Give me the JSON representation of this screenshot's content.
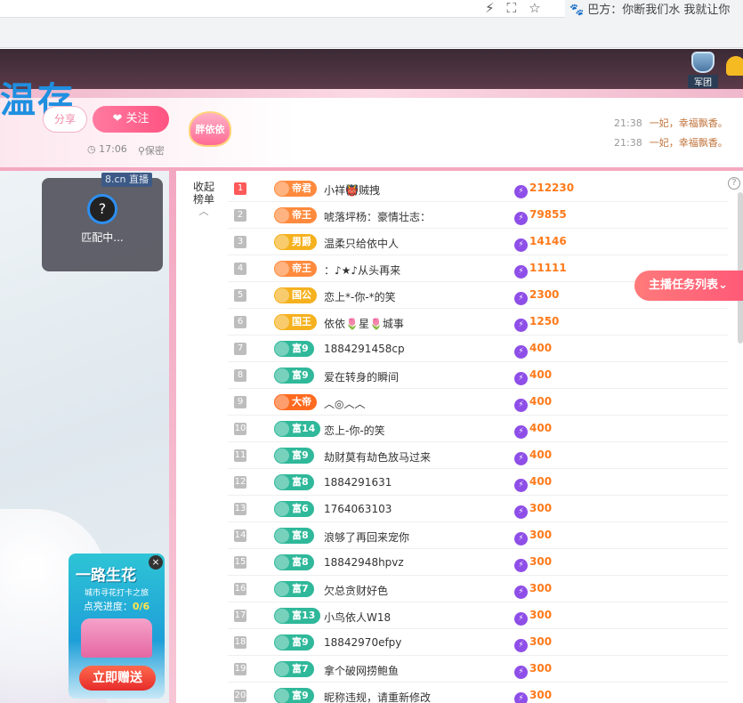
{
  "browser": {
    "extension_text": "巴方：你断我们水 我就让你"
  },
  "room": {
    "big_title": "温存",
    "share_label": "分享",
    "follow_label": "关注",
    "fan_badge": "胖依依",
    "time": "17:06",
    "location": "保密",
    "juntuan_label": "军团"
  },
  "chat": [
    {
      "time": "21:38",
      "text": "一妃，幸福飘香。"
    },
    {
      "time": "21:38",
      "text": "一妃，幸福飘香。"
    }
  ],
  "match": {
    "tag": "8.cn 直播",
    "text": "匹配中..."
  },
  "promo": {
    "title": "一路生花",
    "subtitle": "城市寻花打卡之旅",
    "progress_label": "点亮进度：",
    "progress_value": "0/6",
    "button": "立即赠送"
  },
  "board": {
    "collapse_label": "收起榜单",
    "task_button": "主播任务列表",
    "rows": [
      {
        "rank": "1",
        "badge": "帝君",
        "badge_color": "#ff8a3d",
        "name": "小祥👹贼拽",
        "score": "212230"
      },
      {
        "rank": "2",
        "badge": "帝王",
        "badge_color": "#ff8a3d",
        "name": "唬落坪杨：豪情壮志：",
        "score": "79855"
      },
      {
        "rank": "3",
        "badge": "男爵",
        "badge_color": "#f5b11e",
        "name": "温柔只给依中人",
        "score": "14146"
      },
      {
        "rank": "4",
        "badge": "帝王",
        "badge_color": "#ff8a3d",
        "name": "：♪★♪从头再来",
        "score": "11111"
      },
      {
        "rank": "5",
        "badge": "国公",
        "badge_color": "#f5b11e",
        "name": "恋上*-你-*的笑",
        "score": "2300"
      },
      {
        "rank": "6",
        "badge": "国王",
        "badge_color": "#f5b11e",
        "name": "依依🌷星🌷城事",
        "score": "1250"
      },
      {
        "rank": "7",
        "badge": "富9",
        "badge_color": "#2fb89a",
        "name": "1884291458cp",
        "score": "400"
      },
      {
        "rank": "8",
        "badge": "富9",
        "badge_color": "#2fb89a",
        "name": "爱在转身的瞬间",
        "score": "400"
      },
      {
        "rank": "9",
        "badge": "大帝",
        "badge_color": "#ff6a1f",
        "name": "︿◎︿︿",
        "score": "400"
      },
      {
        "rank": "10",
        "badge": "富14",
        "badge_color": "#2fb89a",
        "name": "恋上-你-的笑",
        "score": "400"
      },
      {
        "rank": "11",
        "badge": "富9",
        "badge_color": "#2fb89a",
        "name": "劫财莫有劫色放马过来",
        "score": "400"
      },
      {
        "rank": "12",
        "badge": "富8",
        "badge_color": "#2fb89a",
        "name": "1884291631",
        "score": "400"
      },
      {
        "rank": "13",
        "badge": "富6",
        "badge_color": "#2fb89a",
        "name": "1764063103",
        "score": "300"
      },
      {
        "rank": "14",
        "badge": "富8",
        "badge_color": "#2fb89a",
        "name": "浪够了再回来宠你",
        "score": "300"
      },
      {
        "rank": "15",
        "badge": "富8",
        "badge_color": "#2fb89a",
        "name": "18842948hpvz",
        "score": "300"
      },
      {
        "rank": "16",
        "badge": "富7",
        "badge_color": "#2fb89a",
        "name": "欠总贪财好色",
        "score": "300"
      },
      {
        "rank": "17",
        "badge": "富13",
        "badge_color": "#2fb89a",
        "name": "小鸟依人W18",
        "score": "300"
      },
      {
        "rank": "18",
        "badge": "富9",
        "badge_color": "#2fb89a",
        "name": "18842970efpy",
        "score": "300"
      },
      {
        "rank": "19",
        "badge": "富7",
        "badge_color": "#2fb89a",
        "name": "拿个破网捞鲍鱼",
        "score": "300"
      },
      {
        "rank": "20",
        "badge": "富9",
        "badge_color": "#2fb89a",
        "name": "昵称违规，请重新修改",
        "score": "300"
      }
    ]
  }
}
